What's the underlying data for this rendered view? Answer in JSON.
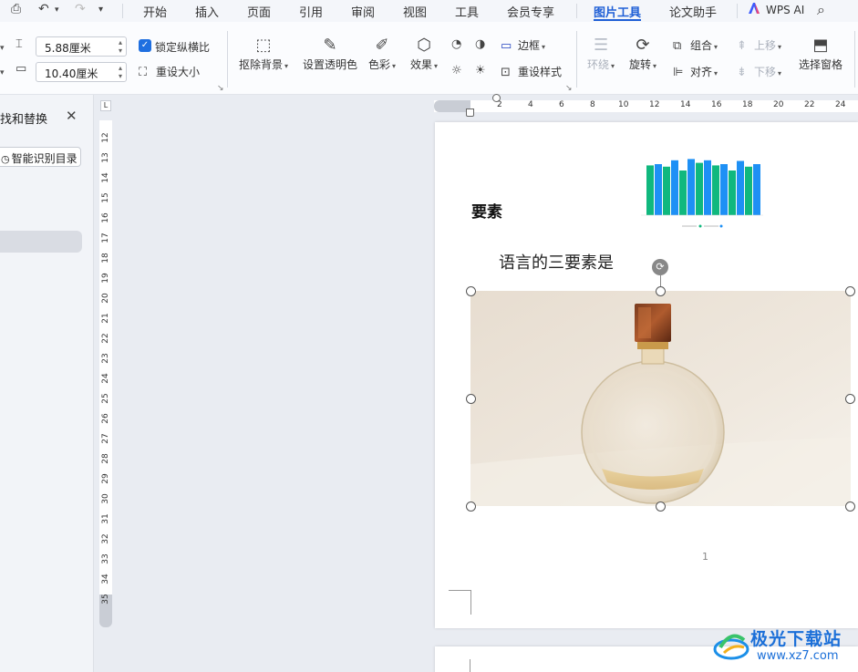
{
  "menubar": {
    "tabs": [
      {
        "label": "开始"
      },
      {
        "label": "插入"
      },
      {
        "label": "页面"
      },
      {
        "label": "引用"
      },
      {
        "label": "审阅"
      },
      {
        "label": "视图"
      },
      {
        "label": "工具"
      },
      {
        "label": "会员专享"
      },
      {
        "label": "图片工具",
        "active": true
      },
      {
        "label": "论文助手"
      },
      {
        "label": "WPS AI"
      }
    ]
  },
  "ribbon": {
    "height_value": "5.88厘米",
    "width_value": "10.40厘米",
    "lock_ratio_label": "锁定纵横比",
    "lock_ratio_checked": true,
    "reset_size_label": "重设大小",
    "remove_bg_label": "抠除背景",
    "set_transparent_label": "设置透明色",
    "color_label": "色彩",
    "effects_label": "效果",
    "border_label": "边框",
    "reset_style_label": "重设样式",
    "wrap_label": "环绕",
    "rotate_label": "旋转",
    "group_label": "组合",
    "align_label": "对齐",
    "bring_forward_label": "上移",
    "send_backward_label": "下移",
    "selection_pane_label": "选择窗格"
  },
  "left_pane": {
    "title": "找和替换",
    "toc_button": "智能识别目录"
  },
  "rulers": {
    "vertical": [
      "12",
      "13",
      "14",
      "15",
      "16",
      "17",
      "18",
      "19",
      "20",
      "21",
      "22",
      "23",
      "24",
      "25",
      "26",
      "27",
      "28",
      "29",
      "30",
      "31",
      "32",
      "33",
      "34",
      "35"
    ],
    "horizontal": [
      "2",
      "4",
      "6",
      "8",
      "10",
      "12",
      "14",
      "16",
      "18",
      "20",
      "22",
      "24"
    ]
  },
  "document": {
    "heading": "要素",
    "body_text": "语言的三要素是",
    "page_number": "1"
  },
  "chart_data": {
    "type": "bar",
    "series": [
      {
        "color": "#10b87e",
        "values": [
          78,
          76,
          70,
          82,
          78,
          70,
          76
        ]
      },
      {
        "color": "#1e90f5",
        "values": [
          80,
          86,
          88,
          86,
          80,
          85,
          80
        ]
      }
    ],
    "ylim": [
      0,
      100
    ]
  },
  "watermark": {
    "title": "极光下载站",
    "url": "www.xz7.com"
  },
  "colors": {
    "accent": "#1f5fd6",
    "checkbox": "#1f6fe0"
  }
}
